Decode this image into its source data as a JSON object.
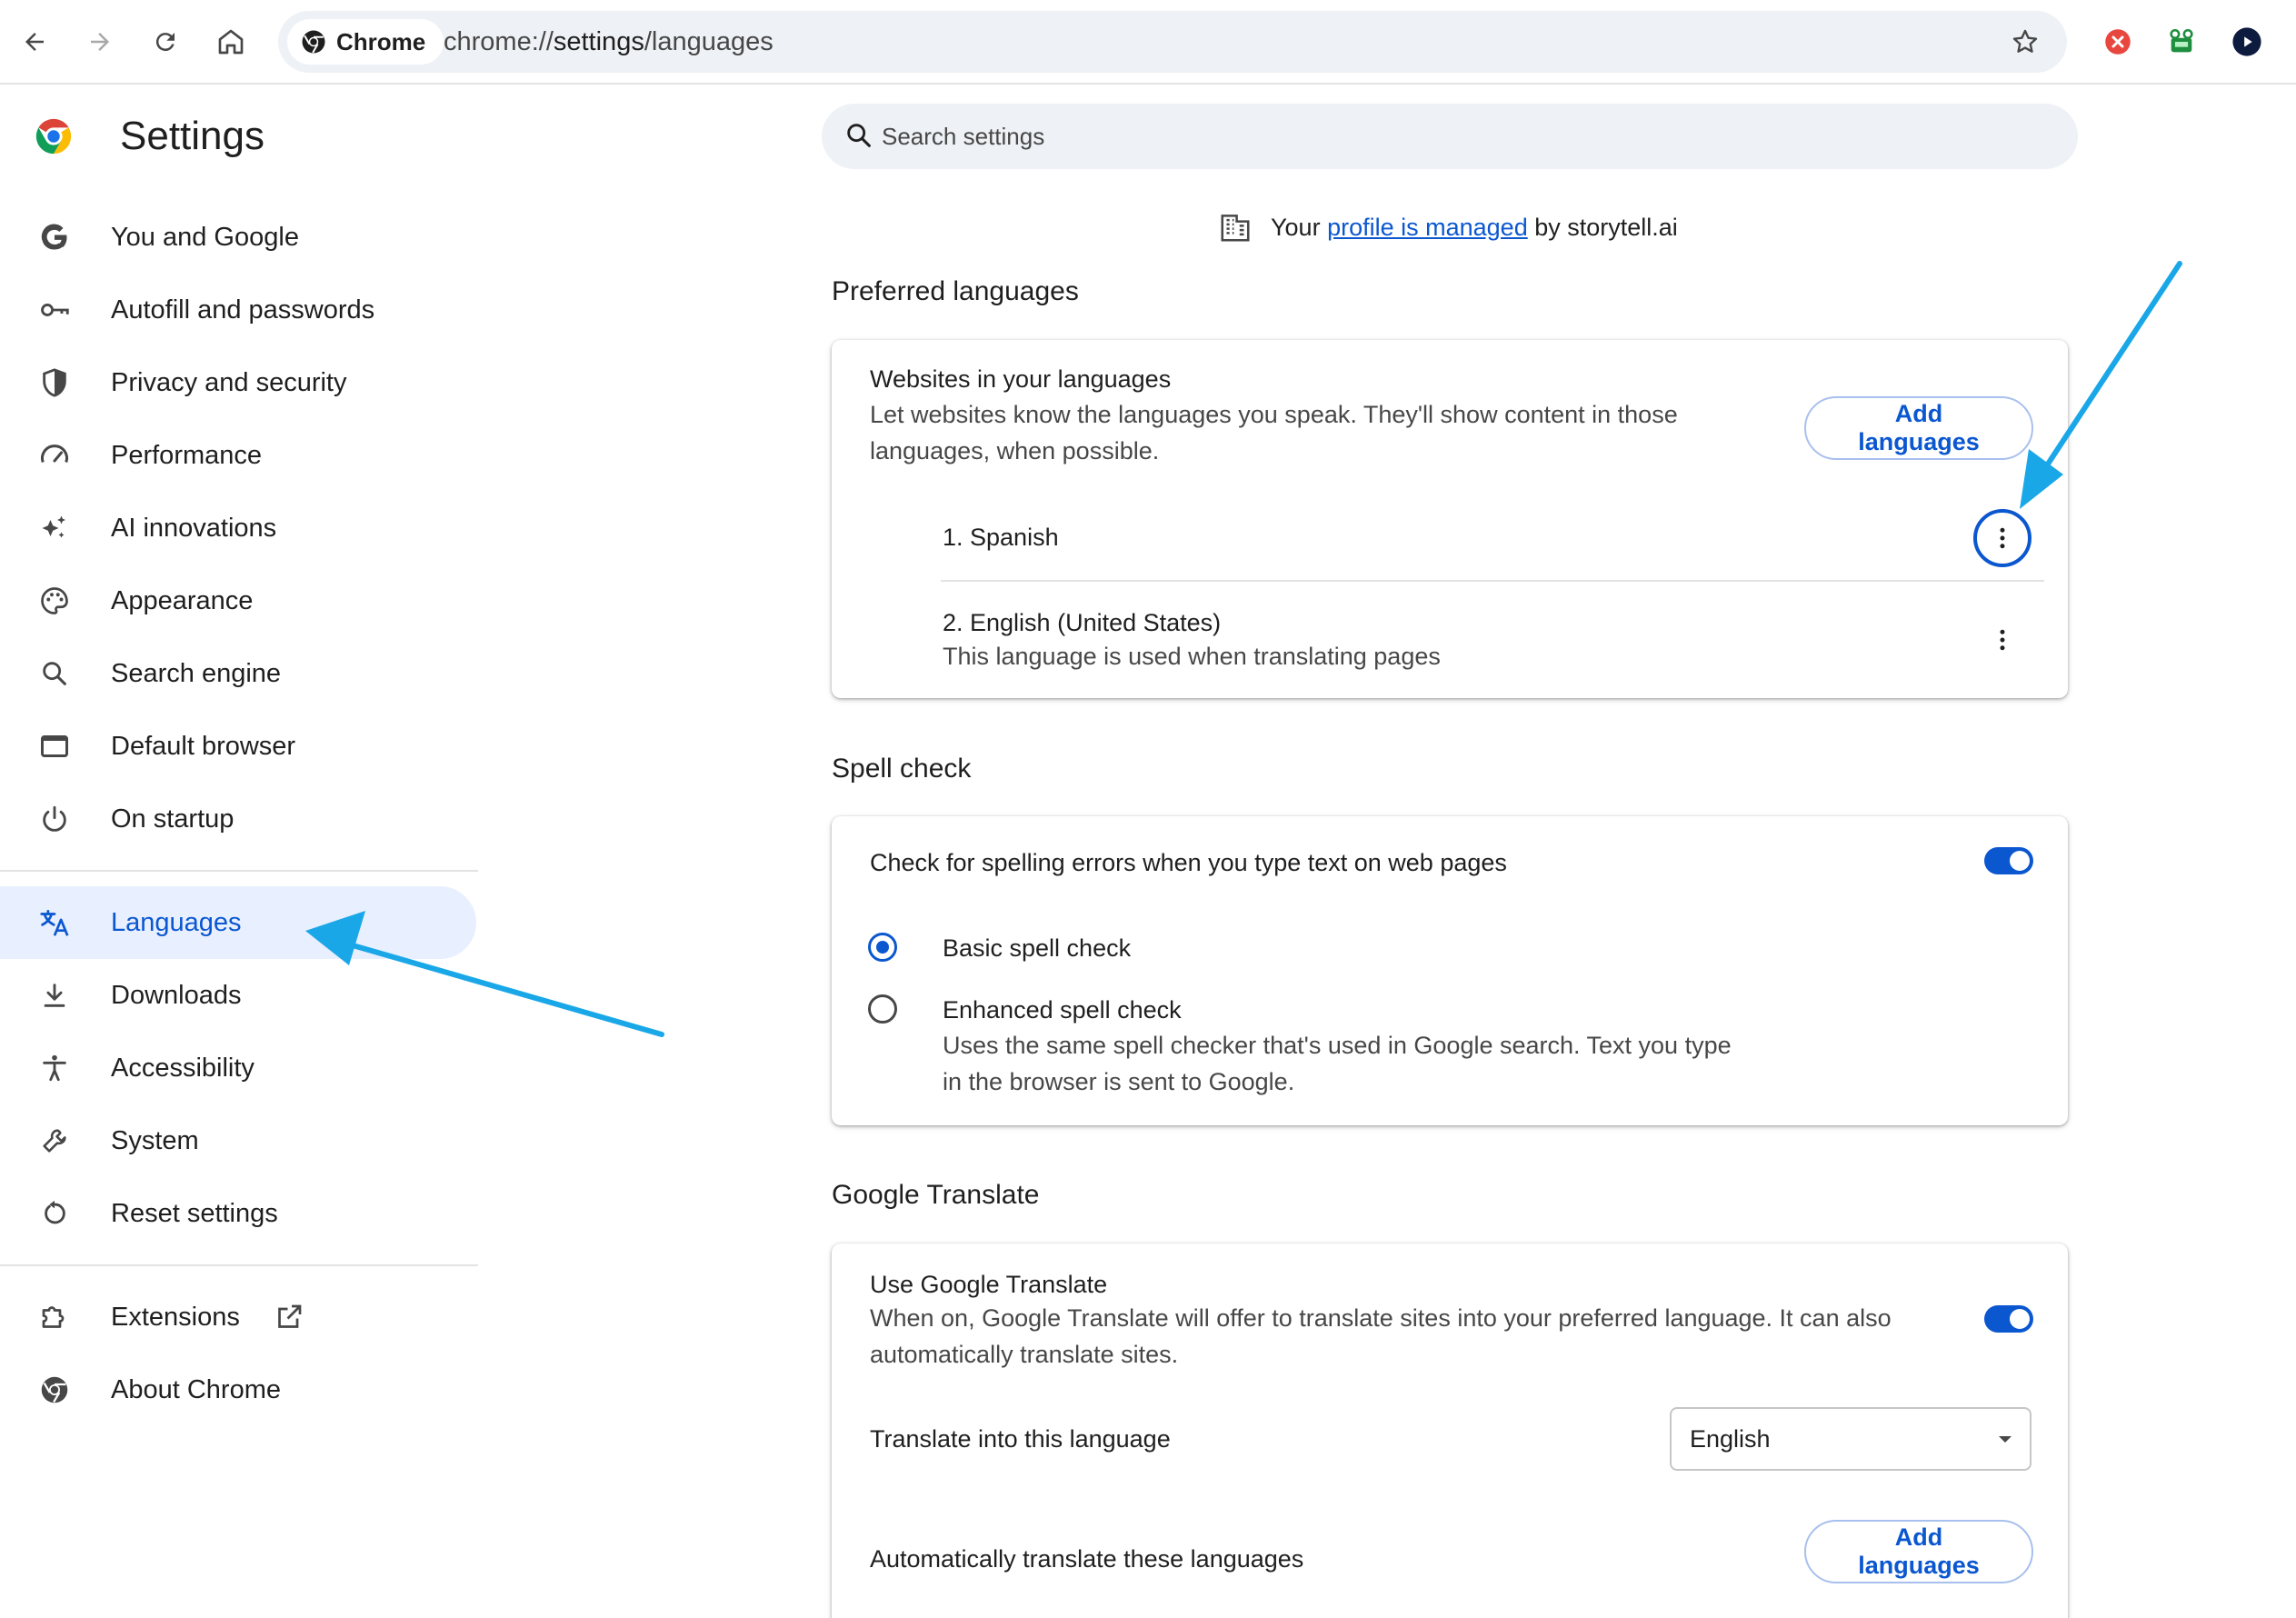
{
  "browser": {
    "chip_label": "Chrome",
    "url_scheme": "chrome://",
    "url_host": "settings",
    "url_path": "/languages"
  },
  "sidebar": {
    "title": "Settings",
    "items": [
      {
        "label": "You and Google",
        "icon": "google-g-icon"
      },
      {
        "label": "Autofill and passwords",
        "icon": "key-icon"
      },
      {
        "label": "Privacy and security",
        "icon": "shield-icon"
      },
      {
        "label": "Performance",
        "icon": "speedometer-icon"
      },
      {
        "label": "AI innovations",
        "icon": "sparkle-icon"
      },
      {
        "label": "Appearance",
        "icon": "palette-icon"
      },
      {
        "label": "Search engine",
        "icon": "search-icon"
      },
      {
        "label": "Default browser",
        "icon": "browser-window-icon"
      },
      {
        "label": "On startup",
        "icon": "power-icon"
      },
      {
        "label": "Languages",
        "icon": "translate-icon",
        "active": true
      },
      {
        "label": "Downloads",
        "icon": "download-icon"
      },
      {
        "label": "Accessibility",
        "icon": "accessibility-icon"
      },
      {
        "label": "System",
        "icon": "wrench-icon"
      },
      {
        "label": "Reset settings",
        "icon": "reset-icon"
      },
      {
        "label": "Extensions",
        "icon": "puzzle-icon"
      },
      {
        "label": "About Chrome",
        "icon": "chrome-icon"
      }
    ]
  },
  "search": {
    "placeholder": "Search settings"
  },
  "managed": {
    "prefix": "Your",
    "link": "profile is managed",
    "suffix": "by storytell.ai"
  },
  "preferred": {
    "section_title": "Preferred languages",
    "heading": "Websites in your languages",
    "desc_line1": "Let websites know the languages you speak. They'll show content in those",
    "desc_line2": "languages, when possible.",
    "add_button": "Add languages",
    "languages": [
      {
        "label": "1. Spanish"
      },
      {
        "label": "2. English (United States)",
        "note": "This language is used when translating pages"
      }
    ]
  },
  "spell": {
    "section_title": "Spell check",
    "toggle_label": "Check for spelling errors when you type text on web pages",
    "toggle_on": true,
    "basic": "Basic spell check",
    "enhanced": "Enhanced spell check",
    "enhanced_desc1": "Uses the same spell checker that's used in Google search. Text you type",
    "enhanced_desc2": "in the browser is sent to Google.",
    "selected": "basic"
  },
  "translate": {
    "section_title": "Google Translate",
    "use_label": "Use Google Translate",
    "desc_line1": "When on, Google Translate will offer to translate sites into your preferred language. It can also",
    "desc_line2": "automatically translate sites.",
    "toggle_on": true,
    "into_label": "Translate into this language",
    "into_value": "English",
    "auto_label": "Automatically translate these languages",
    "auto_button": "Add languages"
  },
  "colors": {
    "accent": "#0b57d0",
    "annotation_arrow": "#1aa7e8"
  }
}
